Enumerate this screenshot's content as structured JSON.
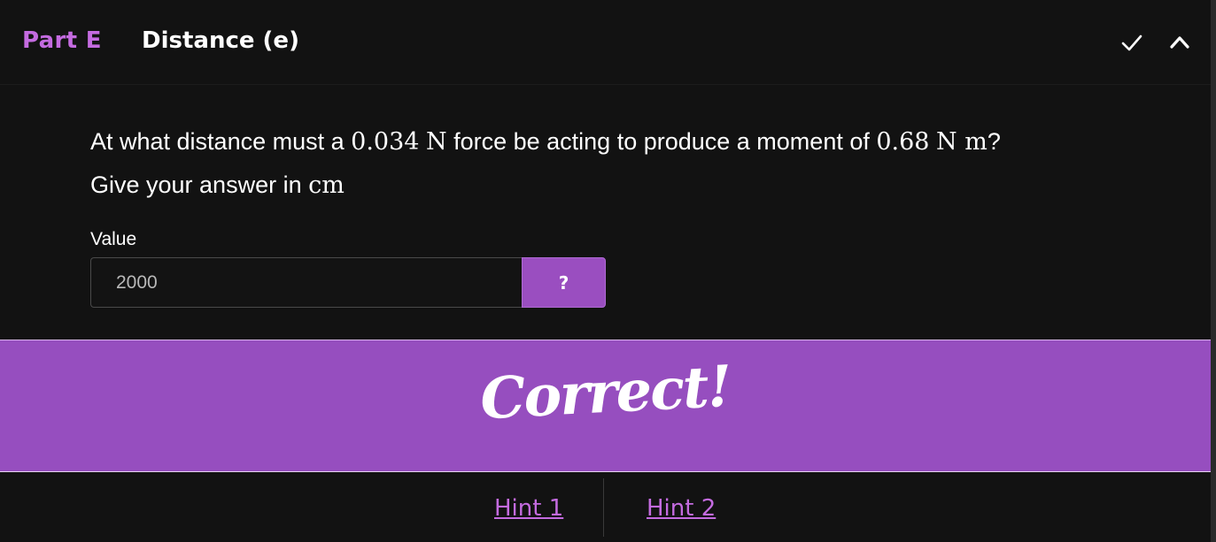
{
  "header": {
    "part_label": "Part E",
    "title": "Distance (e)",
    "icons": [
      "check-icon",
      "chevron-up-icon"
    ]
  },
  "question": {
    "text_1": "At what distance must a ",
    "force_value": "0.034",
    "force_unit": "N",
    "text_2": " force be acting to produce a moment of ",
    "moment_value": "0.68",
    "moment_unit": "N m",
    "text_3": "?",
    "text_4": "Give your answer in ",
    "answer_unit": "cm"
  },
  "answer": {
    "label": "Value",
    "value": "2000",
    "help_label": "?"
  },
  "feedback": {
    "text": "Correct!"
  },
  "hints": [
    "Hint 1",
    "Hint 2"
  ],
  "colors": {
    "accent": "#c46be0",
    "banner": "#964ebf",
    "background": "#121212"
  }
}
